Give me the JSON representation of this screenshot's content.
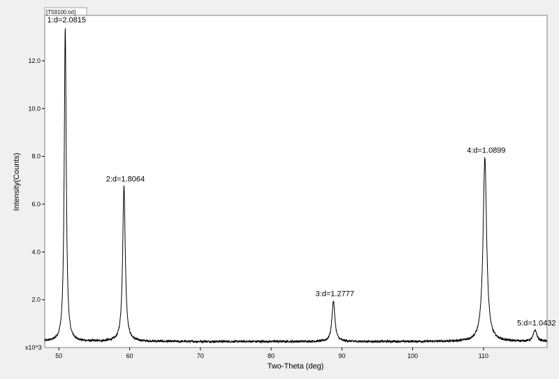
{
  "file_tab": "[T59100.txt]",
  "chart_data": {
    "type": "line",
    "xlabel": "Two-Theta (deg)",
    "ylabel": "Intensity(Counts)",
    "y_multiplier_label": "x10^3",
    "xlim": [
      48,
      119
    ],
    "ylim": [
      0,
      13.9
    ],
    "x_ticks": [
      {
        "value": 50,
        "label": "50"
      },
      {
        "value": 60,
        "label": "60"
      },
      {
        "value": 70,
        "label": "70"
      },
      {
        "value": 80,
        "label": "80"
      },
      {
        "value": 90,
        "label": "90"
      },
      {
        "value": 100,
        "label": "100"
      },
      {
        "value": 110,
        "label": "110"
      }
    ],
    "y_ticks": [
      {
        "value": 2,
        "label": "2.0"
      },
      {
        "value": 4,
        "label": "4.0"
      },
      {
        "value": 6,
        "label": "6.0"
      },
      {
        "value": 8,
        "label": "8.0"
      },
      {
        "value": 10,
        "label": "10.0"
      },
      {
        "value": 12,
        "label": "12.0"
      }
    ],
    "grid": false,
    "series_color": "#000000",
    "baseline": 0.25,
    "peaks": [
      {
        "label": "1:d=2.0815",
        "x": 50.9,
        "y": 13.4,
        "width": 0.17
      },
      {
        "label": "2:d=1.8064",
        "x": 59.2,
        "y": 6.75,
        "width": 0.22
      },
      {
        "label": "3:d=1.2777",
        "x": 88.8,
        "y": 1.95,
        "width": 0.25
      },
      {
        "label": "4:d=1.0899",
        "x": 110.2,
        "y": 7.95,
        "width": 0.3
      },
      {
        "label": "5:d=1.0432",
        "x": 117.3,
        "y": 0.72,
        "width": 0.3
      }
    ]
  }
}
